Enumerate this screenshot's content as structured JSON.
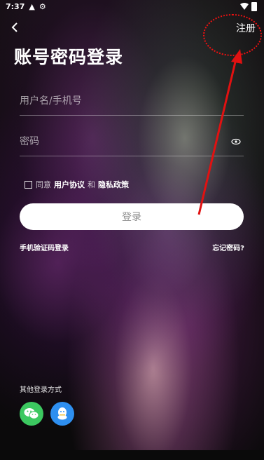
{
  "status_bar": {
    "time": "7:37",
    "alert_icon": "warning-icon",
    "settings_icon": "gear-icon",
    "wifi_icon": "wifi-icon",
    "battery_icon": "battery-icon"
  },
  "header": {
    "back_icon": "back-chevron-icon",
    "register_label": "注册",
    "annotation_color": "#e11111"
  },
  "title": "账号密码登录",
  "form": {
    "username_placeholder": "用户名/手机号",
    "password_placeholder": "密码",
    "username_value": "",
    "password_value": "",
    "password_visibility_icon": "eye-icon"
  },
  "agreement": {
    "checked": false,
    "prefix": "同意",
    "user_agreement": "用户协议",
    "and": "和",
    "privacy_policy": "隐私政策"
  },
  "actions": {
    "login_label": "登录",
    "sms_login_label": "手机验证码登录",
    "forgot_password_label": "忘记密码?"
  },
  "other_login": {
    "label": "其他登录方式",
    "providers": [
      {
        "name": "wechat",
        "icon": "wechat-icon",
        "color": "#3cc860"
      },
      {
        "name": "qq",
        "icon": "qq-icon",
        "color": "#2e8ff0"
      }
    ]
  }
}
